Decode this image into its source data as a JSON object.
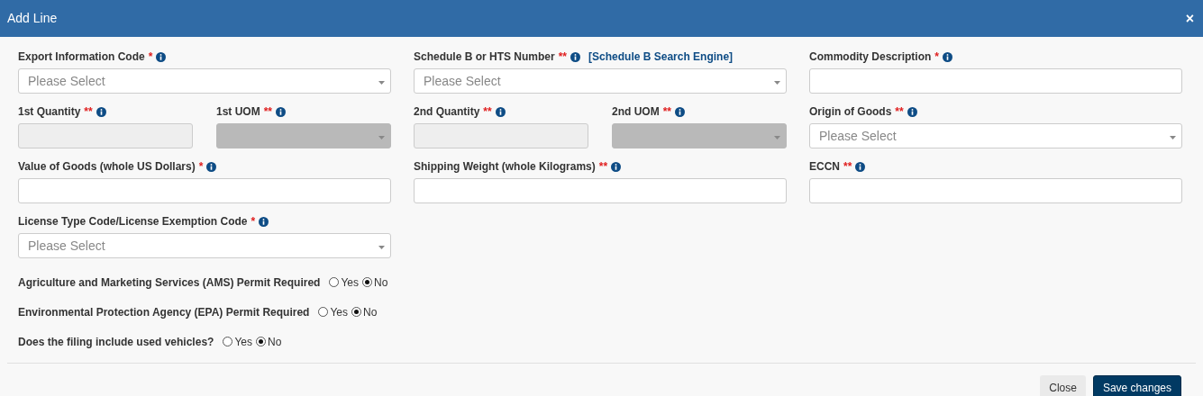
{
  "window": {
    "title": "Add Line",
    "close": "×"
  },
  "rows": [
    {
      "cells": [
        {
          "fields": [
            {
              "label": "Export Information Code",
              "required": "*",
              "kind": "select",
              "placeholder": "Please Select",
              "disabled": false
            }
          ]
        },
        {
          "fields": [
            {
              "label": "Schedule B or HTS Number",
              "required": "**",
              "link": "[Schedule B Search Engine]",
              "kind": "select",
              "placeholder": "Please Select",
              "disabled": false
            }
          ]
        },
        {
          "fields": [
            {
              "label": "Commodity Description",
              "required": "*",
              "kind": "text",
              "disabled": false
            }
          ]
        }
      ]
    },
    {
      "cells": [
        {
          "fields": [
            {
              "label": "1st Quantity",
              "required": "**",
              "kind": "text",
              "disabled": true
            },
            {
              "label": "1st UOM",
              "required": "**",
              "kind": "select",
              "disabled": true
            }
          ]
        },
        {
          "fields": [
            {
              "label": "2nd Quantity",
              "required": "**",
              "kind": "text",
              "disabled": true
            },
            {
              "label": "2nd UOM",
              "required": "**",
              "kind": "select",
              "disabled": true
            }
          ]
        },
        {
          "fields": [
            {
              "label": "Origin of Goods",
              "required": "**",
              "kind": "select",
              "placeholder": "Please Select",
              "disabled": false
            }
          ]
        }
      ]
    },
    {
      "cells": [
        {
          "fields": [
            {
              "label": "Value of Goods (whole US Dollars)",
              "required": "*",
              "kind": "text",
              "disabled": false
            }
          ]
        },
        {
          "fields": [
            {
              "label": "Shipping Weight (whole Kilograms)",
              "required": "**",
              "kind": "text",
              "disabled": false
            }
          ]
        },
        {
          "fields": [
            {
              "label": "ECCN",
              "required": "**",
              "kind": "text",
              "disabled": false
            }
          ]
        }
      ]
    },
    {
      "cells": [
        {
          "fields": [
            {
              "label": "License Type Code/License Exemption Code",
              "required": "*",
              "kind": "select",
              "placeholder": "Please Select",
              "disabled": false
            }
          ]
        }
      ]
    }
  ],
  "questions": [
    {
      "label": "Agriculture and Marketing Services (AMS) Permit Required",
      "options": [
        {
          "label": "Yes",
          "selected": false
        },
        {
          "label": "No",
          "selected": true
        }
      ]
    },
    {
      "label": "Environmental Protection Agency (EPA) Permit Required",
      "options": [
        {
          "label": "Yes",
          "selected": false
        },
        {
          "label": "No",
          "selected": true
        }
      ]
    },
    {
      "label": "Does the filing include used vehicles?",
      "options": [
        {
          "label": "Yes",
          "selected": false
        },
        {
          "label": "No",
          "selected": true
        }
      ]
    }
  ],
  "buttons": [
    {
      "label": "Close",
      "kind": "secondary"
    },
    {
      "label": "Save changes",
      "kind": "primary"
    }
  ]
}
